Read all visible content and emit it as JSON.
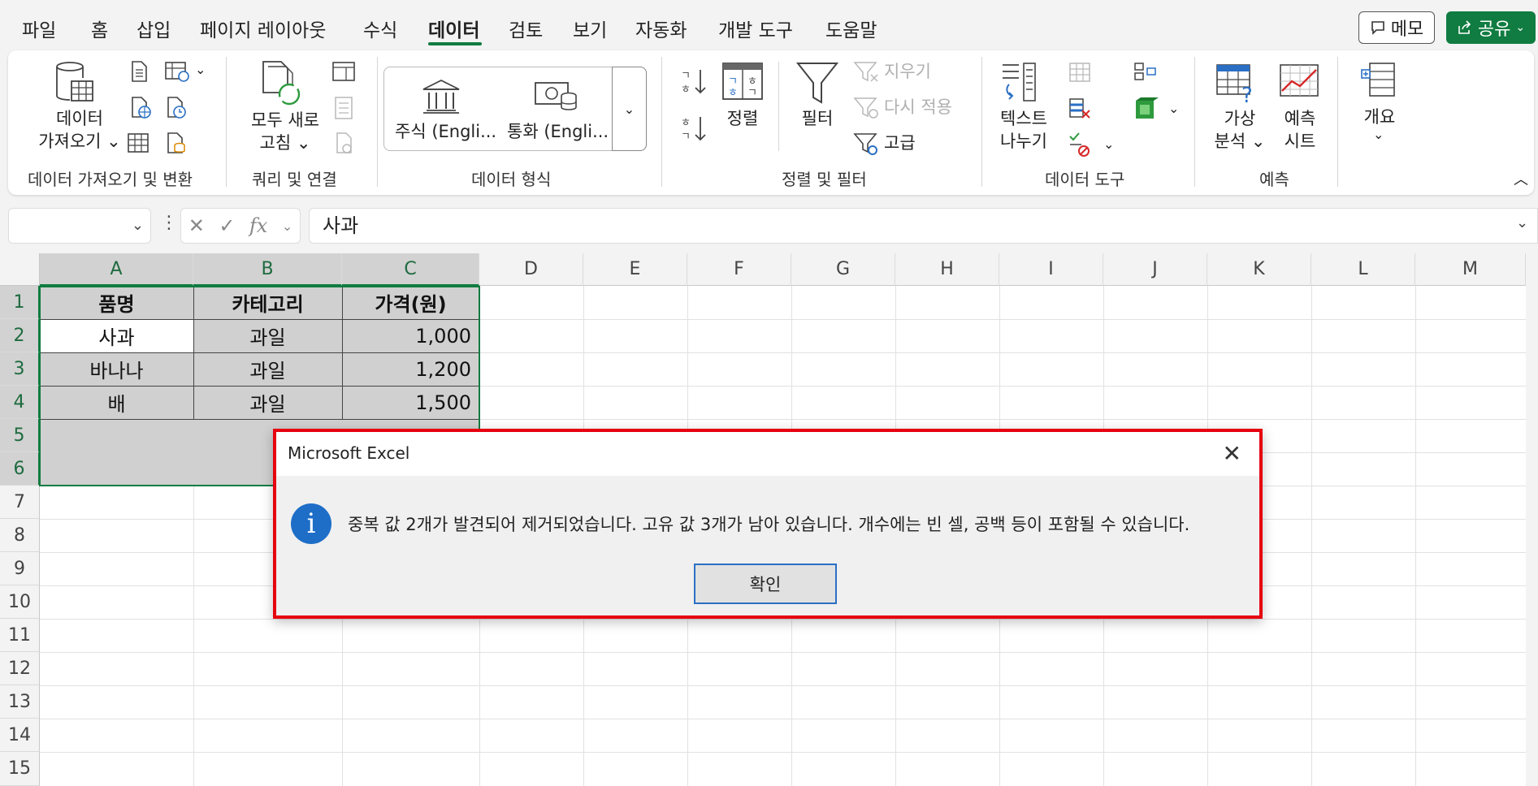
{
  "menu": {
    "tabs": [
      "파일",
      "홈",
      "삽입",
      "페이지 레이아웃",
      "수식",
      "데이터",
      "검토",
      "보기",
      "자동화",
      "개발 도구",
      "도움말"
    ],
    "active_tab": "데이터",
    "memo_label": "메모",
    "share_label": "공유"
  },
  "ribbon": {
    "get_data_label_1": "데이터",
    "get_data_label_2": "가져오기 ⌄",
    "group_get_transform": "데이터 가져오기 및 변환",
    "refresh_label_1": "모두 새로",
    "refresh_label_2": "고침 ⌄",
    "group_queries": "쿼리 및 연결",
    "stocks_label": "주식 (Engli...",
    "currency_label": "통화 (Engli...",
    "group_data_types": "데이터 형식",
    "sort_label": "정렬",
    "filter_label": "필터",
    "clear_label": "지우기",
    "reapply_label": "다시 적용",
    "advanced_label": "고급",
    "group_sort_filter": "정렬 및 필터",
    "text_to_columns_1": "텍스트",
    "text_to_columns_2": "나누기",
    "group_data_tools": "데이터 도구",
    "whatif_1": "가상",
    "whatif_2": "분석 ⌄",
    "forecast_1": "예측",
    "forecast_2": "시트",
    "group_forecast": "예측",
    "outline_label": "개요",
    "sort_az": "ㄱ\nㅎ",
    "sort_za": "ㅎ\nㄱ"
  },
  "formula_bar": {
    "name_box": "",
    "formula": "사과",
    "fx": "fx"
  },
  "sheet": {
    "columns": [
      "A",
      "B",
      "C",
      "D",
      "E",
      "F",
      "G",
      "H",
      "I",
      "J",
      "K",
      "L",
      "M"
    ],
    "rows": [
      "1",
      "2",
      "3",
      "4",
      "5",
      "6",
      "7",
      "8",
      "9",
      "10",
      "11",
      "12",
      "13",
      "14",
      "15"
    ],
    "headers": [
      "품명",
      "카테고리",
      "가격(원)"
    ],
    "data": [
      [
        "사과",
        "과일",
        "1,000"
      ],
      [
        "바나나",
        "과일",
        "1,200"
      ],
      [
        "배",
        "과일",
        "1,500"
      ]
    ]
  },
  "dialog": {
    "title": "Microsoft Excel",
    "message": "중복 값 2개가 발견되어 제거되었습니다. 고유 값 3개가 남아 있습니다. 개수에는 빈 셀, 공백 등이 포함될 수 있습니다.",
    "ok_label": "확인",
    "icon": "info-icon"
  },
  "colors": {
    "accent": "#107c41",
    "highlight_border": "#e6000f",
    "info_blue": "#1e6ec8"
  }
}
